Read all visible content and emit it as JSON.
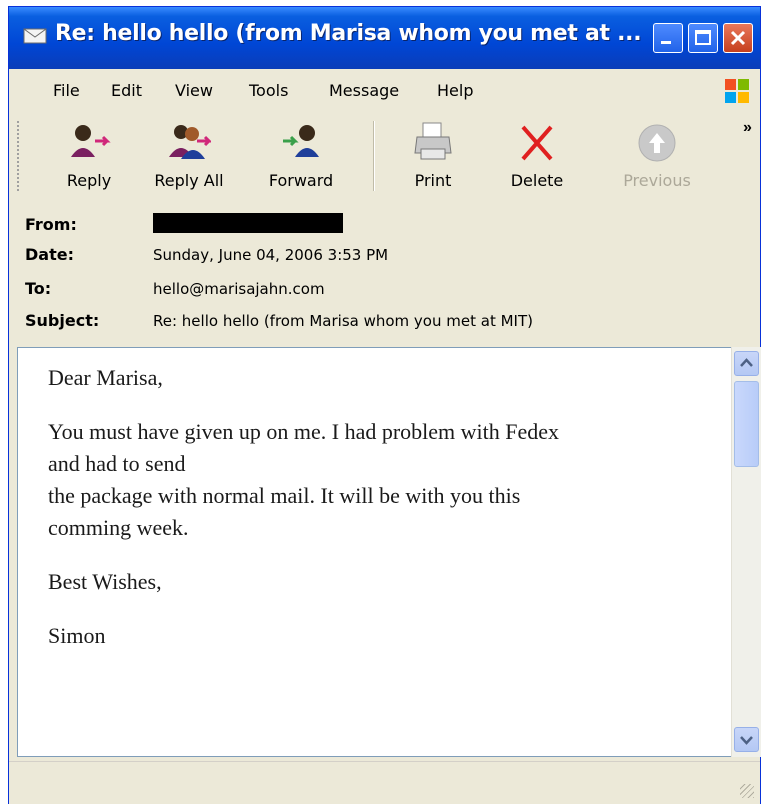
{
  "window": {
    "title": "Re: hello hello (from Marisa whom you met at ..."
  },
  "menu": [
    "File",
    "Edit",
    "View",
    "Tools",
    "Message",
    "Help"
  ],
  "toolbar": {
    "buttons": [
      {
        "label": "Reply",
        "icon": "reply-icon"
      },
      {
        "label": "Reply All",
        "icon": "reply-all-icon"
      },
      {
        "label": "Forward",
        "icon": "forward-icon"
      },
      {
        "label": "Print",
        "icon": "printer-icon"
      },
      {
        "label": "Delete",
        "icon": "delete-x-icon"
      },
      {
        "label": "Previous",
        "icon": "previous-arrow-icon",
        "disabled": true
      }
    ],
    "overflow": "»"
  },
  "header": {
    "from_label": "From:",
    "date_label": "Date:",
    "to_label": "To:",
    "subject_label": "Subject:",
    "date": "Sunday, June 04, 2006 3:53 PM",
    "to": "hello@marisajahn.com",
    "subject": "Re: hello hello (from Marisa whom you met at MIT)"
  },
  "message": {
    "greeting": "Dear Marisa,",
    "para1_line1": "You must have given up on me. I had problem with Fedex",
    "para1_line2": "and had to send",
    "para1_line3": "the package with normal mail. It will be with you this",
    "para1_line4": "comming week.",
    "closing": "Best Wishes,",
    "signature": "Simon"
  },
  "colors": {
    "title_bar": "#0046D5",
    "chrome": "#ECE9D8",
    "delete_red": "#E02020"
  }
}
